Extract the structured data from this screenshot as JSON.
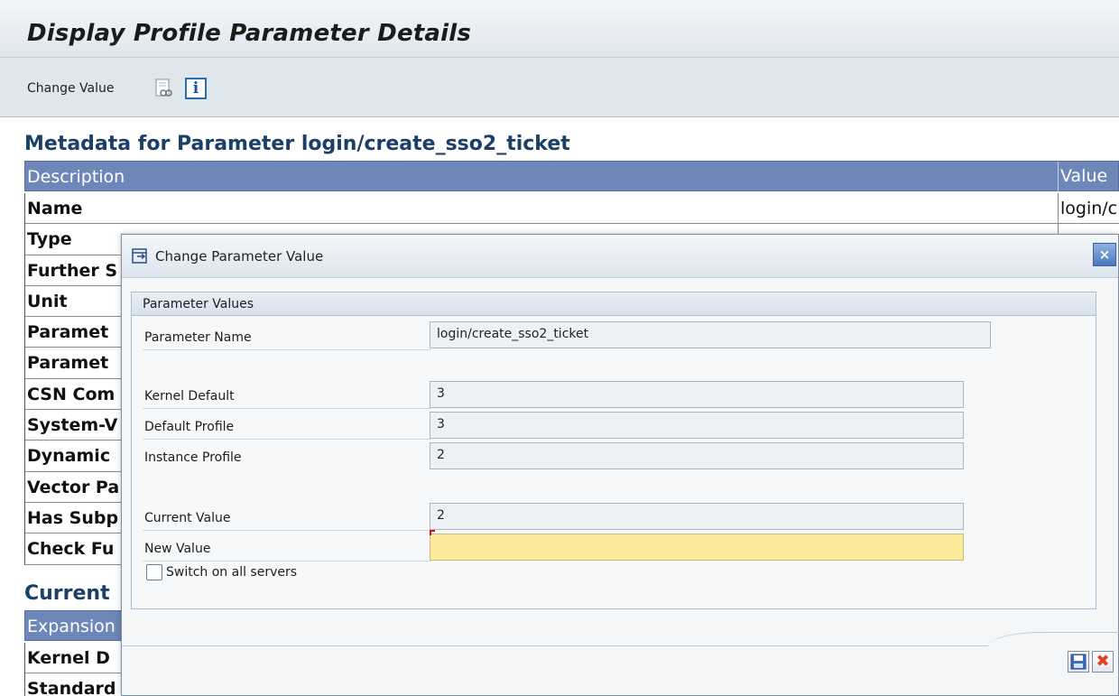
{
  "page": {
    "title": "Display Profile Parameter Details",
    "toolbar": {
      "change_value": "Change Value",
      "info_icon_glyph": "i"
    }
  },
  "metadata": {
    "title": "Metadata for Parameter login/create_sso2_ticket",
    "columns": {
      "description": "Description",
      "value": "Value"
    },
    "rows": [
      {
        "label": "Name",
        "value": "login/c"
      },
      {
        "label": "Type",
        "value": ""
      },
      {
        "label": "Further S",
        "value": ""
      },
      {
        "label": "Unit",
        "value": ""
      },
      {
        "label": "Paramet",
        "value": ""
      },
      {
        "label": "Paramet",
        "value": ""
      },
      {
        "label": "CSN Com",
        "value": ""
      },
      {
        "label": "System-V",
        "value": ""
      },
      {
        "label": "Dynamic",
        "value": ""
      },
      {
        "label": "Vector Pa",
        "value": ""
      },
      {
        "label": "Has Subp",
        "value": ""
      },
      {
        "label": "Check Fu",
        "value": ""
      }
    ]
  },
  "current": {
    "title": "Current",
    "columns": {
      "expansion": "Expansion"
    },
    "rows": [
      {
        "label": "Kernel D"
      },
      {
        "label": "Standard"
      }
    ]
  },
  "dialog": {
    "title": "Change Parameter Value",
    "close_glyph": "×",
    "group_title": "Parameter Values",
    "fields": {
      "parameter_name": {
        "label": "Parameter Name",
        "value": "login/create_sso2_ticket"
      },
      "kernel_default": {
        "label": "Kernel Default",
        "value": "3"
      },
      "default_profile": {
        "label": "Default Profile",
        "value": "3"
      },
      "instance_profile": {
        "label": "Instance Profile",
        "value": "2"
      },
      "current_value": {
        "label": "Current Value",
        "value": "2"
      },
      "new_value": {
        "label": "New Value",
        "value": ""
      }
    },
    "switch_all_servers": "Switch on all servers",
    "cancel_glyph": "✖"
  },
  "colors": {
    "table_header": "#6d87b8",
    "section_title": "#1b3f66",
    "new_value_bg": "#fde99a",
    "cancel_icon": "#e0421b"
  }
}
